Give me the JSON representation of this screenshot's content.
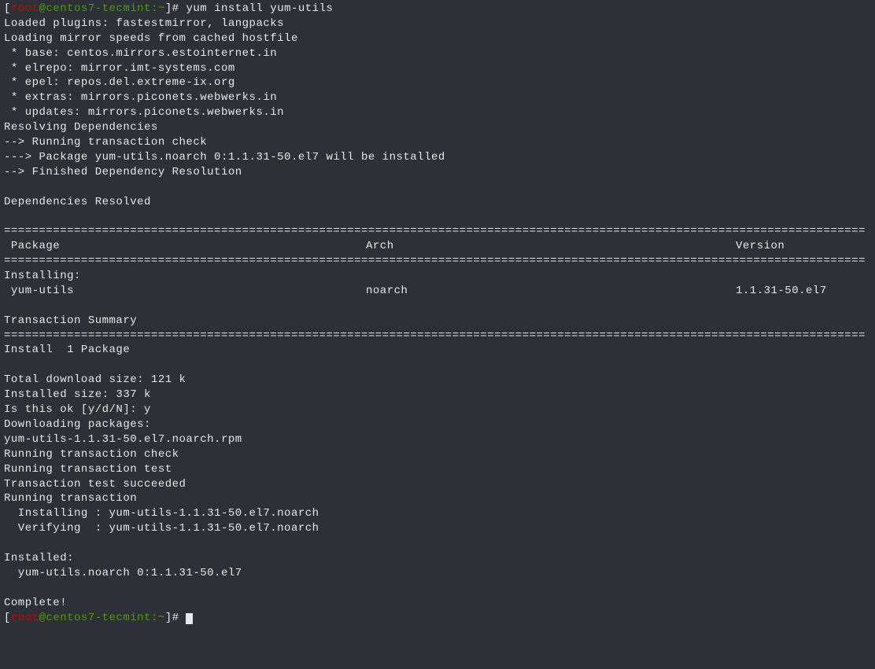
{
  "prompt": {
    "open": "[",
    "user": "root",
    "at": "@",
    "host": "centos7-tecmint",
    "path": ":~",
    "close": "]#",
    "command": " yum install yum-utils"
  },
  "output": {
    "l1": "Loaded plugins: fastestmirror, langpacks",
    "l2": "Loading mirror speeds from cached hostfile",
    "l3": " * base: centos.mirrors.estointernet.in",
    "l4": " * elrepo: mirror.imt-systems.com",
    "l5": " * epel: repos.del.extreme-ix.org",
    "l6": " * extras: mirrors.piconets.webwerks.in",
    "l7": " * updates: mirrors.piconets.webwerks.in",
    "l8": "Resolving Dependencies",
    "l9": "--> Running transaction check",
    "l10": "---> Package yum-utils.noarch 0:1.1.31-50.el7 will be installed",
    "l11": "--> Finished Dependency Resolution",
    "l12": "Dependencies Resolved",
    "eqline": "===========================================================================================================================",
    "header_pkg": " Package",
    "header_arch": "Arch",
    "header_ver": "Version",
    "installing": "Installing:",
    "row_pkg": " yum-utils",
    "row_arch": "noarch",
    "row_ver": "1.1.31-50.el7",
    "trans_summary": "Transaction Summary",
    "install_count": "Install  1 Package",
    "dl_size": "Total download size: 121 k",
    "inst_size": "Installed size: 337 k",
    "confirm": "Is this ok [y/d/N]: y",
    "downloading": "Downloading packages:",
    "rpm": "yum-utils-1.1.31-50.el7.noarch.rpm",
    "running_check": "Running transaction check",
    "running_test": "Running transaction test",
    "test_succ": "Transaction test succeeded",
    "running_trans": "Running transaction",
    "installing_pkg": "  Installing : yum-utils-1.1.31-50.el7.noarch",
    "verifying_pkg": "  Verifying  : yum-utils-1.1.31-50.el7.noarch",
    "installed": "Installed:",
    "installed_pkg": "  yum-utils.noarch 0:1.1.31-50.el7",
    "complete": "Complete!"
  },
  "prompt2": {
    "open": "[",
    "user": "root",
    "at": "@",
    "host": "centos7-tecmint",
    "path": ":~",
    "close": "]#",
    "command": " "
  }
}
